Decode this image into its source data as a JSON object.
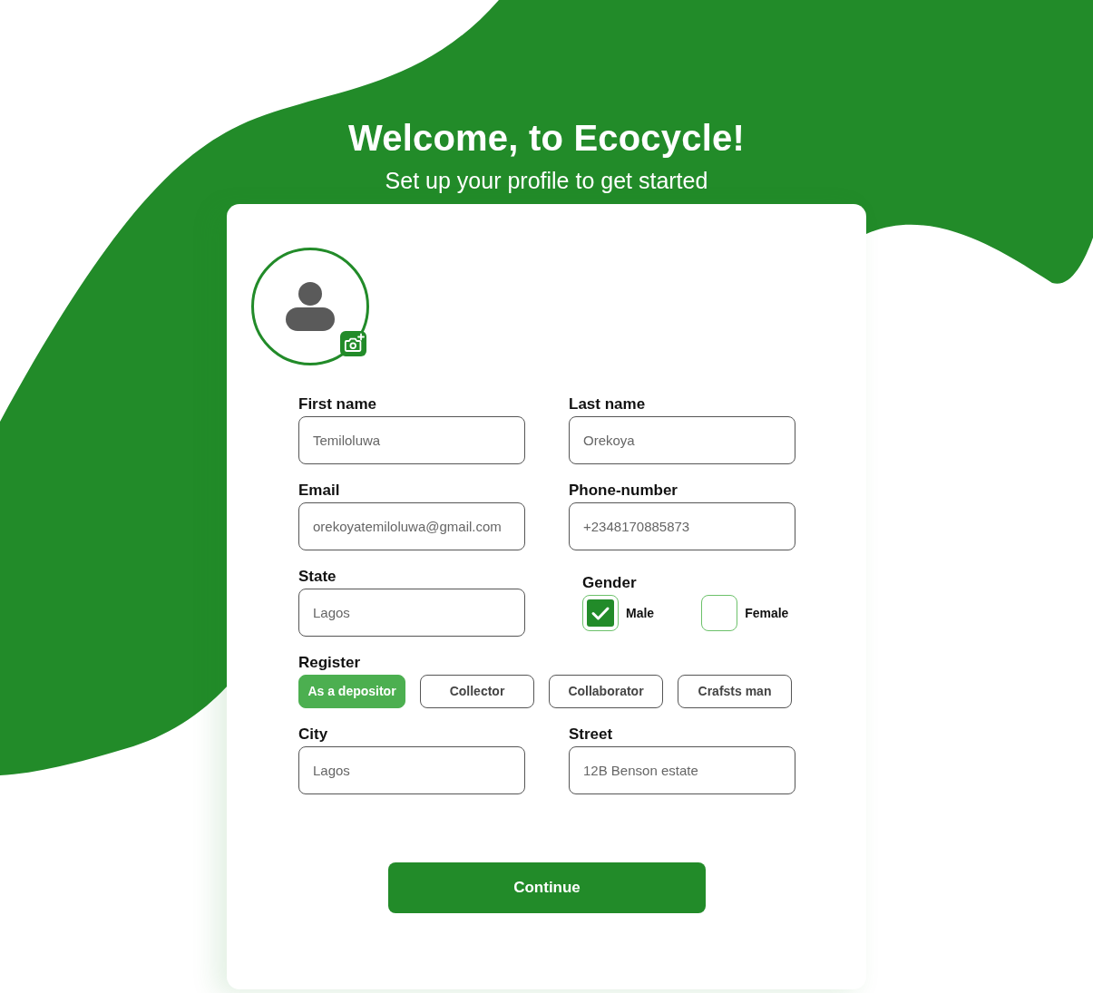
{
  "header": {
    "title": "Welcome, to Ecocycle!",
    "subtitle": "Set up your profile to get started"
  },
  "profile_form": {
    "fields": [
      {
        "label": "First name",
        "value": "Temiloluwa"
      },
      {
        "label": "Last name",
        "value": "Orekoya"
      },
      {
        "label": "Email",
        "value": "orekoyatemiloluwa@gmail.com"
      },
      {
        "label": "Phone-number",
        "value": "+2348170885873"
      },
      {
        "label": "State",
        "value": "Lagos"
      }
    ],
    "gender": {
      "label": "Gender",
      "options": [
        {
          "label": "Male",
          "checked": true
        },
        {
          "label": "Female",
          "checked": false
        }
      ]
    },
    "register": {
      "label": "Register",
      "options": [
        {
          "label": "As a depositor",
          "selected": true
        },
        {
          "label": "Collector",
          "selected": false
        },
        {
          "label": "Collaborator",
          "selected": false
        },
        {
          "label": "Crafsts man",
          "selected": false
        }
      ]
    },
    "address_fields": [
      {
        "label": "City",
        "value": "Lagos"
      },
      {
        "label": "Street",
        "value": "12B Benson estate"
      }
    ]
  },
  "continue_button": {
    "label": "Continue"
  }
}
